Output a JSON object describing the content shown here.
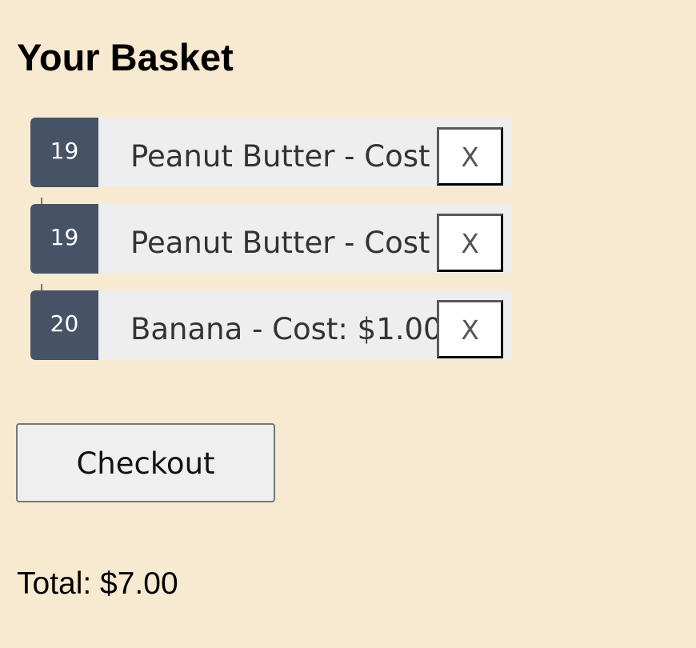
{
  "page": {
    "title": "Your Basket",
    "background_color": "#f8e9d1"
  },
  "basket": {
    "items": [
      {
        "id": "19",
        "label": "Peanut Butter - Cost",
        "remove_label": "X"
      },
      {
        "id": "19",
        "label": "Peanut Butter - Cost",
        "remove_label": "X"
      },
      {
        "id": "20",
        "label": "Banana - Cost: $1.00",
        "remove_label": "X"
      }
    ],
    "id_badge_color": "#465266",
    "item_background_color": "#eeeeee"
  },
  "checkout": {
    "label": "Checkout"
  },
  "summary": {
    "total": "Total: $7.00"
  }
}
